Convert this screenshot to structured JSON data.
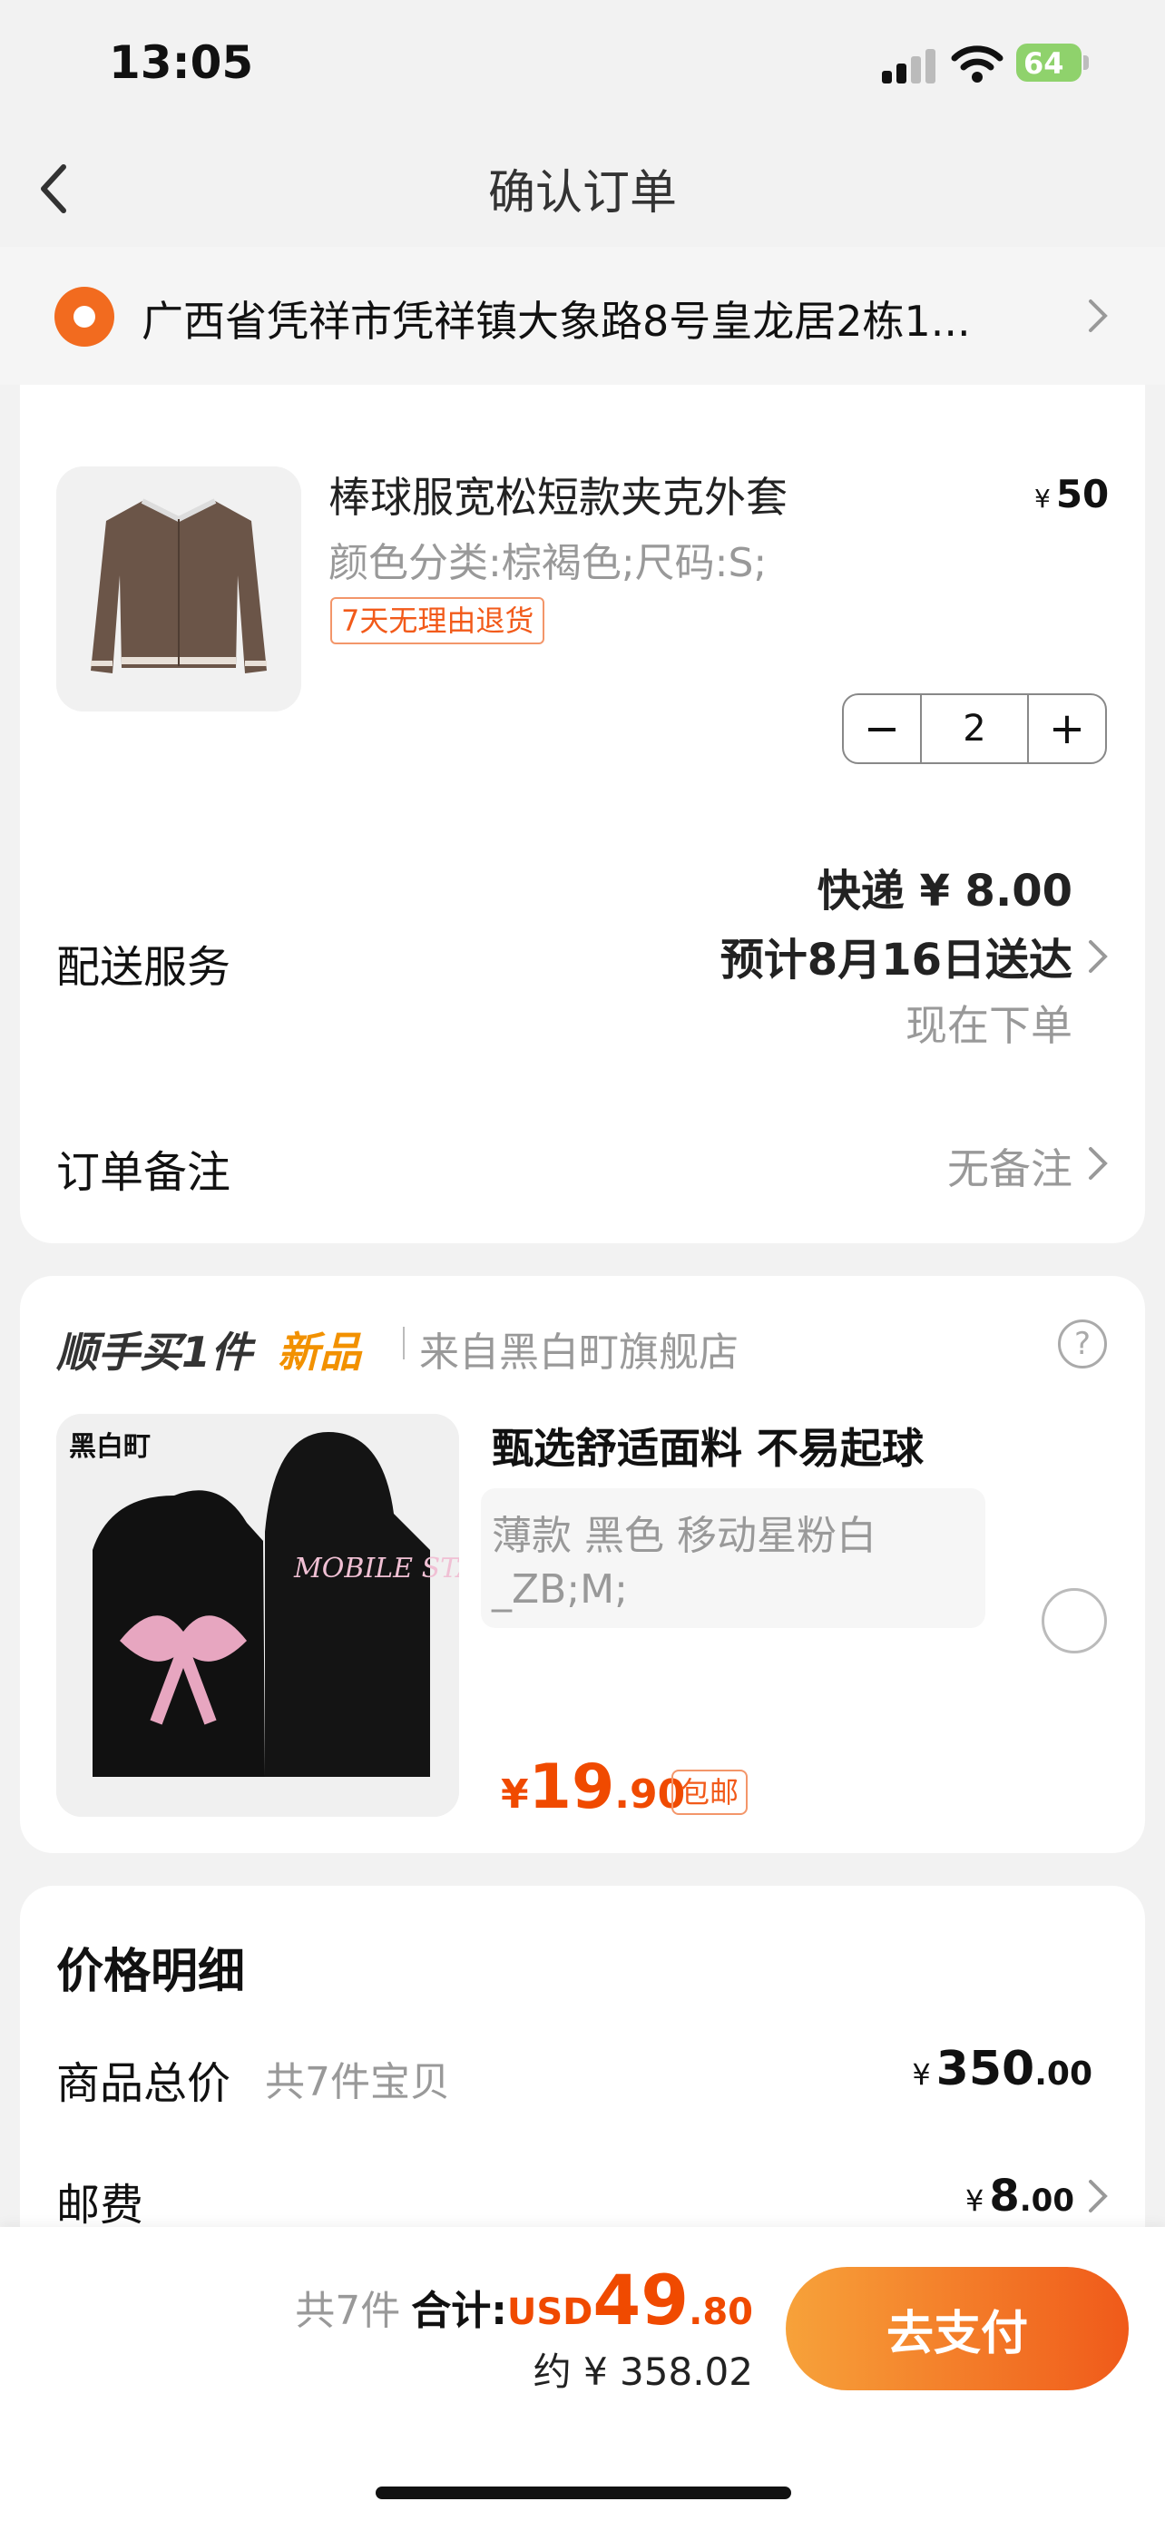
{
  "status_bar": {
    "time": "13:05",
    "battery": "64"
  },
  "nav": {
    "title": "确认订单"
  },
  "address": {
    "text": "广西省凭祥市凭祥镇大象路8号皇龙居2栋1..."
  },
  "order": {
    "product": {
      "name": "棒球服宽松短款夹克外套",
      "price_symbol": "¥",
      "price": "50",
      "spec": "颜色分类:棕褐色;尺码:S;",
      "return_tag": "7天无理由退货",
      "quantity": "2"
    },
    "delivery": {
      "label": "配送服务",
      "fee": "快递 ¥ 8.00",
      "eta": "预计8月16日送达",
      "order_now": "现在下单"
    },
    "remark": {
      "label": "订单备注",
      "value": "无备注"
    }
  },
  "upsell": {
    "title": "顺手买1件",
    "new": "新品",
    "store": "来自黑白町旗舰店",
    "help": "?",
    "headline": "甄选舒适面料 不易起球",
    "spec_line1": "薄款 黑色 移动星粉白",
    "spec_line2": "_ZB;M;",
    "price_currency": "¥",
    "price_int": "19",
    "price_dec": ".90",
    "free_ship_tag": "包邮",
    "image_brand": "黑白町",
    "image_caption": "MOBILE STARS"
  },
  "price_detail": {
    "title": "价格明细",
    "total_label": "商品总价",
    "total_count": "共7件宝贝",
    "total_symbol": "¥",
    "total_int": "350",
    "total_dec": ".00",
    "shipping_label": "邮费",
    "shipping_symbol": "¥",
    "shipping_int": "8",
    "shipping_dec": ".00"
  },
  "bottom": {
    "count": "共7件",
    "sum_label": "合计:",
    "currency": "USD",
    "amount_int": "49",
    "amount_dec": ".80",
    "approx": "约 ¥ 358.02",
    "pay_label": "去支付"
  },
  "colors": {
    "accent": "#f04a00",
    "pay_start": "#f7a23a",
    "pay_end": "#f05a1a",
    "location": "#f26b1f"
  },
  "icons": [
    "back-icon",
    "location-pin-icon",
    "chevron-right-icon",
    "minus-icon",
    "plus-icon",
    "help-icon",
    "radio-icon",
    "signal-icon",
    "wifi-icon",
    "battery-icon"
  ]
}
